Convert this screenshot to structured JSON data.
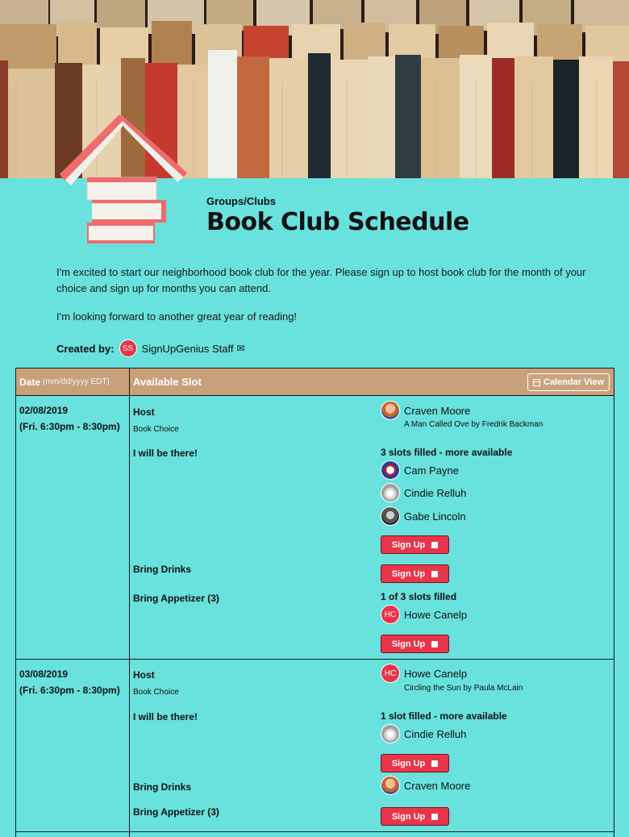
{
  "header": {
    "category": "Groups/Clubs",
    "title": "Book Club Schedule"
  },
  "intro": {
    "paragraph1": "I'm excited to start our neighborhood book club for the year. Please sign up to host book club for the month of your choice and sign up for months you can attend.",
    "paragraph2": "I'm looking forward to another great year of reading!"
  },
  "creator": {
    "label": "Created by:",
    "initials": "SS",
    "name": "SignUpGenius Staff"
  },
  "table": {
    "date_header": "Date",
    "date_format": "(mm/dd/yyyy EDT)",
    "slot_header": "Available Slot",
    "calendar_button": "Calendar View",
    "signup_label": "Sign Up",
    "rows": [
      {
        "date": "02/08/2019",
        "time": "(Fri. 6:30pm - 8:30pm)",
        "host_label": "Host",
        "host_sub": "Book Choice",
        "host_name": "Craven Moore",
        "host_note": "A Man Called Ove by Fredrik Backman",
        "attend_label": "I will be there!",
        "attend_status": "3 slots filled - more available",
        "attendees": [
          "Cam Payne",
          "Cindie Relluh",
          "Gabe Lincoln"
        ],
        "drinks_label": "Bring Drinks",
        "appetizer_label": "Bring Appetizer (3)",
        "appetizer_status": "1 of 3 slots filled",
        "appetizer_initials": "HC",
        "appetizer_name": "Howe Canelp"
      },
      {
        "date": "03/08/2019",
        "time": "(Fri. 6:30pm - 8:30pm)",
        "host_label": "Host",
        "host_sub": "Book Choice",
        "host_initials": "HC",
        "host_name": "Howe Canelp",
        "host_note": "Circling the Sun by Paula McLain",
        "attend_label": "I will be there!",
        "attend_status": "1 slot filled - more available",
        "attendee": "Cindie Relluh",
        "drinks_label": "Bring Drinks",
        "drinks_name": "Craven Moore",
        "appetizer_label": "Bring Appetizer (3)"
      }
    ]
  },
  "colors": {
    "background": "#69e1dd",
    "header_bar": "#c8a079",
    "accent": "#e8354a"
  }
}
